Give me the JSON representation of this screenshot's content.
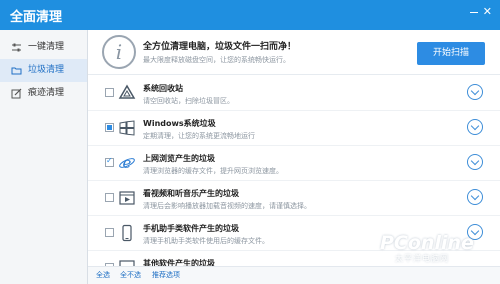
{
  "window": {
    "title": "全面清理"
  },
  "sidebar": {
    "items": [
      {
        "label": "一键清理",
        "icon": "sliders-icon",
        "active": false
      },
      {
        "label": "垃圾清理",
        "icon": "folder-icon",
        "active": true
      },
      {
        "label": "痕迹清理",
        "icon": "edit-icon",
        "active": false
      }
    ]
  },
  "header": {
    "title": "全方位清理电脑，垃圾文件一扫而净！",
    "subtitle": "最大限度释放磁盘空间，让您的系统畅快运行。",
    "scan_button": "开始扫描"
  },
  "rows": [
    {
      "title": "系统回收站",
      "subtitle": "请空回收站，扫除垃圾冒区。",
      "check": "none",
      "icon": "recycle-icon"
    },
    {
      "title": "Windows系统垃圾",
      "subtitle": "定期清理，让您的系统更流畅地运行",
      "check": "partial",
      "icon": "windows-icon"
    },
    {
      "title": "上网浏览产生的垃圾",
      "subtitle": "清理浏览器的缓存文件，提升网页浏览速度。",
      "check": "checked",
      "icon": "ie-icon"
    },
    {
      "title": "看视频和听音乐产生的垃圾",
      "subtitle": "清理后会影响播放器加载音视频的速度，请谨慎选择。",
      "check": "none",
      "icon": "film-icon"
    },
    {
      "title": "手机助手类软件产生的垃圾",
      "subtitle": "清理手机助手类软件使用后的缓存文件。",
      "check": "none",
      "icon": "phone-icon"
    },
    {
      "title": "其他软件产生的垃圾",
      "subtitle": "",
      "check": "none",
      "icon": "software-icon"
    }
  ],
  "footer": {
    "select_all": "全选",
    "select_none": "全不选",
    "recommended": "推荐选项"
  },
  "watermark": {
    "brand": "PConline",
    "sub": "太平洋电脑网"
  },
  "colors": {
    "titlebar": "#1f8fe0",
    "accent": "#2d8ce3",
    "link": "#1f6fc4"
  }
}
